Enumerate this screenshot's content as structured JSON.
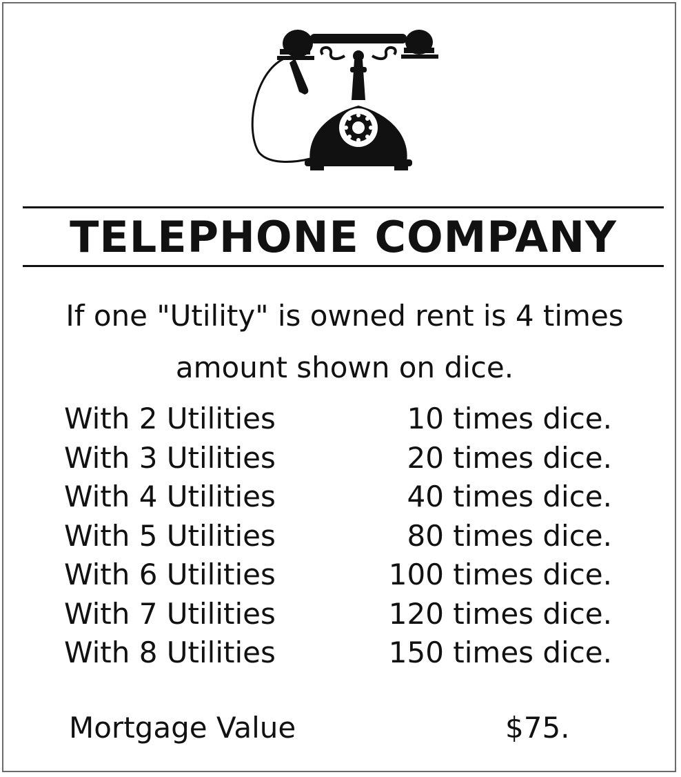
{
  "card": {
    "title": "TELEPHONE COMPANY",
    "icon": "telephone-icon",
    "description_line1": "If one \"Utility\" is owned rent is 4 times",
    "description_line2": "amount shown on dice.",
    "rent_rows": [
      {
        "label": "With 2 Utilities",
        "value": "10 times dice."
      },
      {
        "label": "With 3 Utilities",
        "value": "20 times dice."
      },
      {
        "label": "With 4 Utilities",
        "value": "40 times dice."
      },
      {
        "label": "With 5 Utilities",
        "value": "80 times dice."
      },
      {
        "label": "With 6 Utilities",
        "value": "100 times dice."
      },
      {
        "label": "With 7 Utilities",
        "value": "120 times dice."
      },
      {
        "label": "With 8 Utilities",
        "value": "150 times dice."
      }
    ],
    "mortgage_label": "Mortgage Value",
    "mortgage_value": "$75."
  },
  "colors": {
    "ink": "#111111",
    "border": "#6a6a6a",
    "background": "#ffffff"
  }
}
